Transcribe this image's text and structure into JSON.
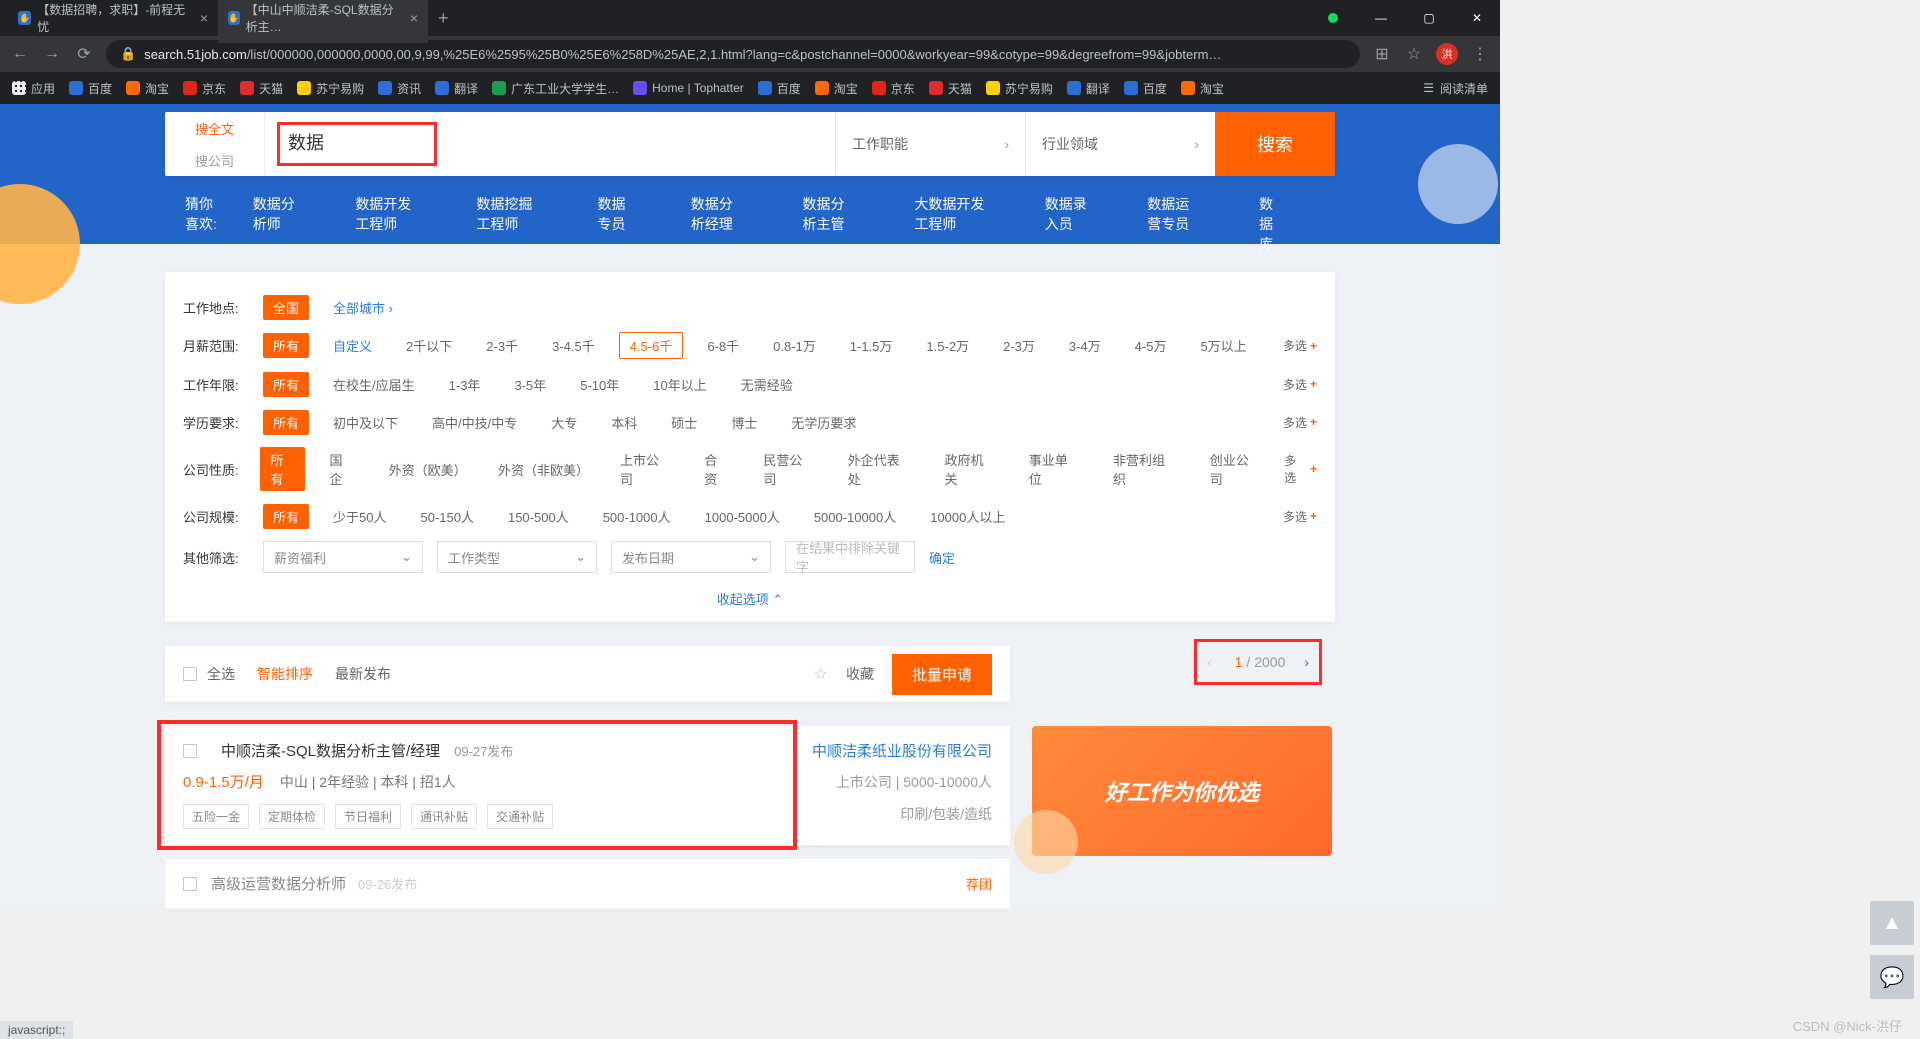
{
  "browser": {
    "tabs": [
      {
        "title": "【数据招聘，求职】-前程无忧",
        "active": false
      },
      {
        "title": "【中山中顺洁柔-SQL数据分析主…",
        "active": true
      }
    ],
    "url_host": "search.51job.com",
    "url_path": "/list/000000,000000,0000,00,9,99,%25E6%2595%25B0%25E6%258D%25AE,2,1.html?lang=c&postchannel=0000&workyear=99&cotype=99&degreefrom=99&jobterm…",
    "avatar": "洪",
    "reading_list": "阅读清单",
    "apps_label": "应用",
    "bookmarks": [
      {
        "label": "百度",
        "color": "#2a6fd6"
      },
      {
        "label": "淘宝",
        "color": "#ff6a00"
      },
      {
        "label": "京东",
        "color": "#e2231a"
      },
      {
        "label": "天猫",
        "color": "#e02c2c"
      },
      {
        "label": "苏宁易购",
        "color": "#ffcf00"
      },
      {
        "label": "资讯",
        "color": "#2a6fd6"
      },
      {
        "label": "翻译",
        "color": "#2a6fd6"
      },
      {
        "label": "广东工业大学学生…",
        "color": "#1a9e4b"
      },
      {
        "label": "Home | Tophatter",
        "color": "#6a4cff"
      },
      {
        "label": "百度",
        "color": "#2a6fd6"
      },
      {
        "label": "淘宝",
        "color": "#ff6a00"
      },
      {
        "label": "京东",
        "color": "#e2231a"
      },
      {
        "label": "天猫",
        "color": "#e02c2c"
      },
      {
        "label": "苏宁易购",
        "color": "#ffcf00"
      },
      {
        "label": "翻译",
        "color": "#2a6fd6"
      },
      {
        "label": "百度",
        "color": "#2a6fd6"
      },
      {
        "label": "淘宝",
        "color": "#ff6a00"
      }
    ]
  },
  "search": {
    "tab_fulltext": "搜全文",
    "tab_company": "搜公司",
    "keyword": "数据",
    "job_function": "工作职能",
    "industry": "行业领域",
    "go": "搜索"
  },
  "suggestions": {
    "label": "猜你喜欢:",
    "items": [
      "数据分析师",
      "数据开发工程师",
      "数据挖掘工程师",
      "数据专员",
      "数据分析经理",
      "数据分析主管",
      "大数据开发工程师",
      "数据录入员",
      "数据运营专员",
      "数据库"
    ]
  },
  "filters": {
    "location": {
      "label": "工作地点:",
      "all": "全国",
      "city": "全部城市"
    },
    "salary": {
      "label": "月薪范围:",
      "all": "所有",
      "custom": "自定义",
      "opts": [
        "2千以下",
        "2-3千",
        "3-4.5千",
        "4.5-6千",
        "6-8千",
        "0.8-1万",
        "1-1.5万",
        "1.5-2万",
        "2-3万",
        "3-4万",
        "4-5万",
        "5万以上"
      ],
      "hot_index": 3
    },
    "years": {
      "label": "工作年限:",
      "all": "所有",
      "opts": [
        "在校生/应届生",
        "1-3年",
        "3-5年",
        "5-10年",
        "10年以上",
        "无需经验"
      ]
    },
    "degree": {
      "label": "学历要求:",
      "all": "所有",
      "opts": [
        "初中及以下",
        "高中/中技/中专",
        "大专",
        "本科",
        "硕士",
        "博士",
        "无学历要求"
      ]
    },
    "ctype": {
      "label": "公司性质:",
      "all": "所有",
      "opts": [
        "国企",
        "外资（欧美）",
        "外资（非欧美）",
        "上市公司",
        "合资",
        "民营公司",
        "外企代表处",
        "政府机关",
        "事业单位",
        "非营利组织",
        "创业公司"
      ]
    },
    "csize": {
      "label": "公司规模:",
      "all": "所有",
      "opts": [
        "少于50人",
        "50-150人",
        "150-500人",
        "500-1000人",
        "1000-5000人",
        "5000-10000人",
        "10000人以上"
      ]
    },
    "other": {
      "label": "其他筛选:",
      "d1": "薪资福利",
      "d2": "工作类型",
      "d3": "发布日期",
      "exclude_ph": "在结果中排除关键字",
      "ok": "确定"
    },
    "more": "多选",
    "collapse": "收起选项"
  },
  "toolbar": {
    "select_all": "全选",
    "sort_smart": "智能排序",
    "sort_new": "最新发布",
    "fav": "收藏",
    "apply": "批量申请",
    "page_current": "1",
    "page_total": "2000"
  },
  "job": {
    "title": "中顺洁柔-SQL数据分析主管/经理",
    "date": "09-27发布",
    "company": "中顺洁柔纸业股份有限公司",
    "salary": "0.9-1.5万/月",
    "meta": "中山 | 2年经验 | 本科 | 招1人",
    "company_info": "上市公司 | 5000-10000人",
    "tags": [
      "五险一金",
      "定期体检",
      "节日福利",
      "通讯补贴",
      "交通补贴"
    ],
    "industry": "印刷/包装/造纸"
  },
  "job2": {
    "title": "高级运营数据分析师",
    "date": "09-26发布",
    "badge": "荐团"
  },
  "banner": "好工作为你优选",
  "status": "javascript:;",
  "watermark": "CSDN @Nick-洪仔"
}
